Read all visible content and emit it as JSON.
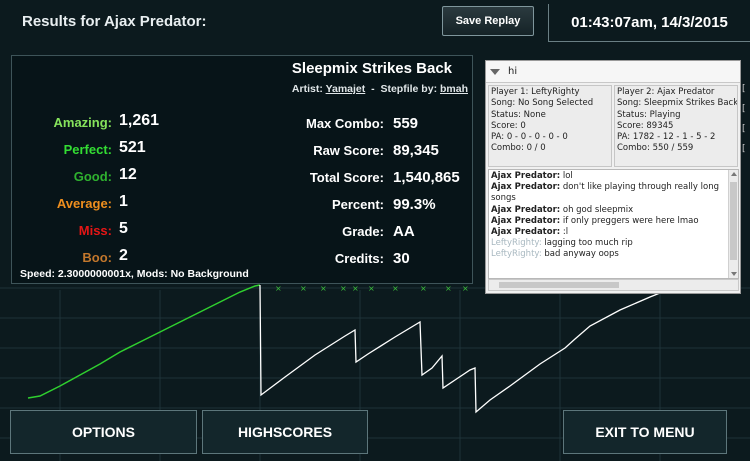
{
  "header": {
    "title": "Results for Ajax Predator:",
    "save_replay": "Save Replay",
    "clock": "01:43:07am, 14/3/2015"
  },
  "song": {
    "title": "Sleepmix Strikes Back",
    "artist_label": "Artist:",
    "artist": "Yamajet",
    "separator": "-",
    "stepfile_label": "Stepfile by:",
    "stepfile": "bmah"
  },
  "judgements": [
    {
      "label": "Amazing:",
      "value": "1,261",
      "color": "#86e35c"
    },
    {
      "label": "Perfect:",
      "value": "521",
      "color": "#33dd33"
    },
    {
      "label": "Good:",
      "value": "12",
      "color": "#2fb22f"
    },
    {
      "label": "Average:",
      "value": "1",
      "color": "#ef8f1e"
    },
    {
      "label": "Miss:",
      "value": "5",
      "color": "#e51616"
    },
    {
      "label": "Boo:",
      "value": "2",
      "color": "#c2772c"
    }
  ],
  "stats": [
    {
      "label": "Max Combo:",
      "value": "559"
    },
    {
      "label": "Raw Score:",
      "value": "89,345"
    },
    {
      "label": "Total Score:",
      "value": "1,540,865"
    },
    {
      "label": "Percent:",
      "value": "99.3%"
    },
    {
      "label": "Grade:",
      "value": "AA"
    },
    {
      "label": "Credits:",
      "value": "30"
    }
  ],
  "speed_line": "Speed: 2.3000000001x, Mods: No Background",
  "buttons": {
    "options": "OPTIONS",
    "highscores": "HIGHSCORES",
    "exit": "EXIT TO MENU"
  },
  "chat": {
    "title": "hi",
    "player1": {
      "name": "Player 1: LeftyRighty",
      "song": "Song: No Song Selected",
      "status": "Status: None",
      "score": "Score: 0",
      "pa": "PA: 0 - 0 - 0 - 0 - 0",
      "combo": "Combo: 0 / 0"
    },
    "player2": {
      "name": "Player 2: Ajax Predator",
      "song": "Song: Sleepmix Strikes Back",
      "status": "Status: Playing",
      "score": "Score: 89345",
      "pa": "PA: 1782 - 12 - 1 - 5 - 2",
      "combo": "Combo: 550 / 559"
    },
    "messages": [
      {
        "nick": "Ajax Predator:",
        "text": " lol",
        "dim": false
      },
      {
        "nick": "Ajax Predator:",
        "text": " don't like playing through really long songs",
        "dim": false
      },
      {
        "nick": "Ajax Predator:",
        "text": " oh god sleepmix",
        "dim": false
      },
      {
        "nick": "Ajax Predator:",
        "text": " if only preggers were here lmao",
        "dim": false
      },
      {
        "nick": "Ajax Predator:",
        "text": " :l",
        "dim": false
      },
      {
        "nick": "LeftyRighty:",
        "text": " lagging too much rip",
        "dim": true
      },
      {
        "nick": "LeftyRighty:",
        "text": " bad anyway oops",
        "dim": true
      }
    ]
  },
  "side_brackets": [
    "[",
    "[",
    "[",
    "["
  ],
  "graph": {
    "fc_color": "#2fcf2f",
    "normal_color": "#ffffff",
    "marker_color": "#3bbf3b"
  }
}
